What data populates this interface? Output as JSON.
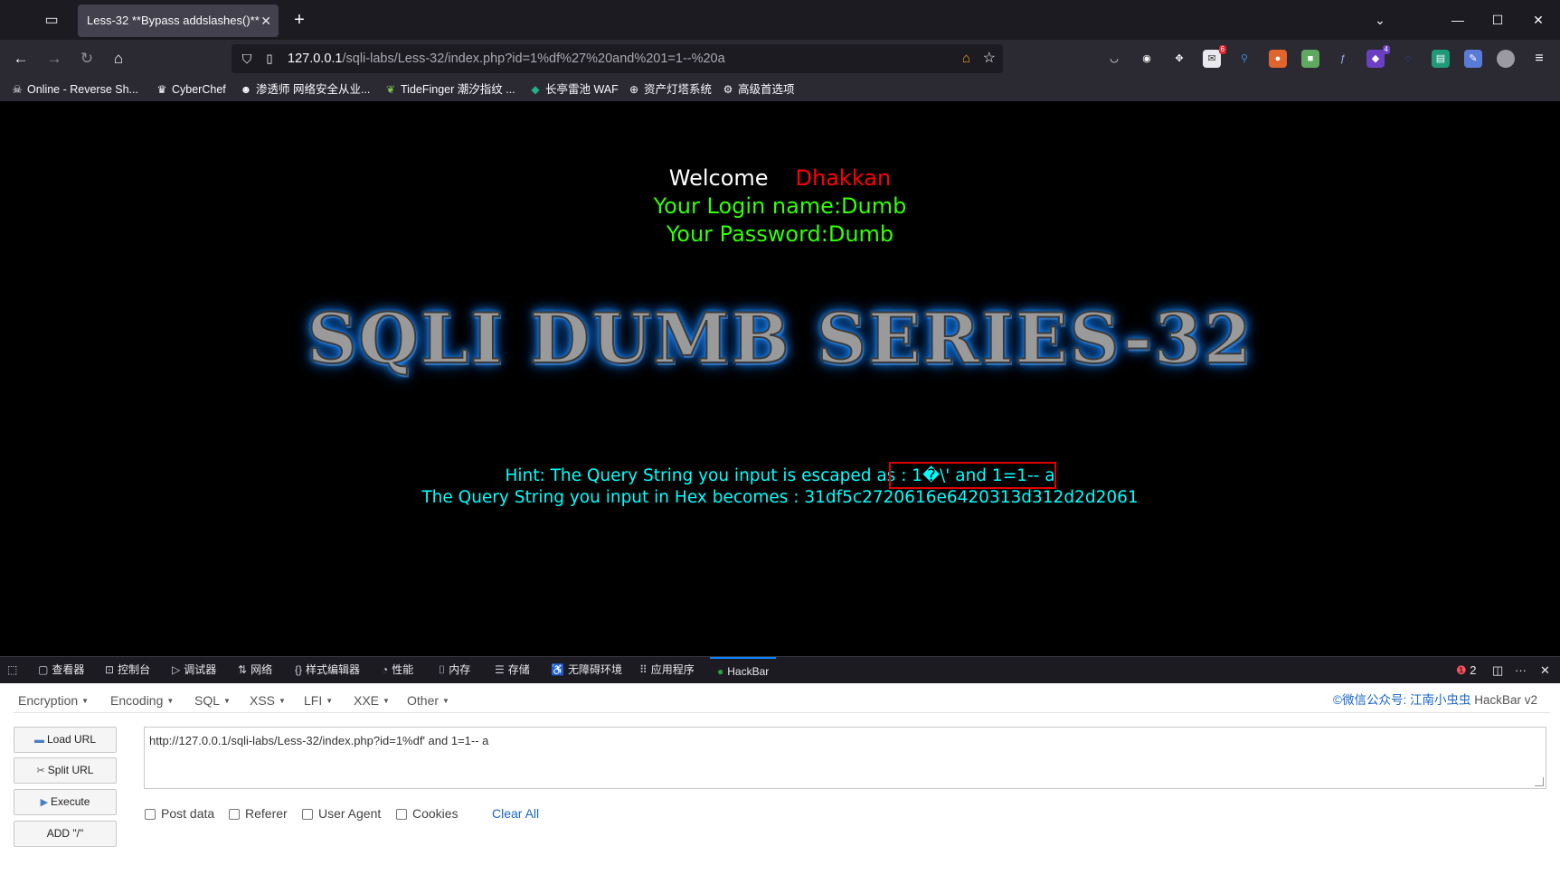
{
  "tab": {
    "title": "Less-32 **Bypass addslashes()**",
    "close": "✕",
    "new": "+"
  },
  "window": {
    "minimize": "—",
    "maximize": "☐",
    "close": "✕",
    "list_all": "⌄"
  },
  "nav": {
    "back": "←",
    "forward": "→",
    "reload": "↻",
    "home": "⌂",
    "url_host": "127.0.0.1",
    "url_rest": "/sqli-labs/Less-32/index.php?id=1%df%27%20and%201=1--%20a",
    "extension_badges": [
      "6",
      "4"
    ],
    "menu": "≡"
  },
  "bookmarks": [
    {
      "label": "Online - Reverse Sh...",
      "icon": "skull-icon",
      "glyph": "☠"
    },
    {
      "label": "CyberChef",
      "icon": "chef-hat-icon",
      "glyph": "♛"
    },
    {
      "label": "渗透师 网络安全从业...",
      "icon": "mask-icon",
      "glyph": "☻"
    },
    {
      "label": "TideFinger 潮汐指纹 ...",
      "icon": "leaf-icon",
      "glyph": "❦"
    },
    {
      "label": "长亭雷池 WAF",
      "icon": "shield-icon",
      "glyph": "◆"
    },
    {
      "label": "资产灯塔系统",
      "icon": "globe-icon",
      "glyph": "⊕"
    },
    {
      "label": "高级首选项",
      "icon": "gear-icon",
      "glyph": "⚙"
    }
  ],
  "page": {
    "welcome": "Welcome",
    "user": "Dhakkan",
    "login": "Your Login name:Dumb",
    "password": "Your Password:Dumb",
    "banner": "SQLI DUMB SERIES-32",
    "hint": "Hint: The Query String you input is escaped as : 1�\\' and 1=1-- a",
    "hex": "The Query String you input in Hex becomes : 31df5c2720616e6420313d312d2d2061"
  },
  "devtools": {
    "tabs": [
      "查看器",
      "控制台",
      "调试器",
      "网络",
      "样式编辑器",
      "性能",
      "内存",
      "存储",
      "无障碍环境",
      "应用程序",
      "HackBar"
    ],
    "error_count": "2",
    "more": "···",
    "close": "✕"
  },
  "hackbar": {
    "menu": [
      "Encryption",
      "Encoding",
      "SQL",
      "XSS",
      "LFI",
      "XXE",
      "Other"
    ],
    "credit_link": "©微信公众号: 江南小虫虫",
    "credit_name": "HackBar v2",
    "buttons": {
      "load": "Load URL",
      "split": "Split URL",
      "execute": "Execute",
      "add": "ADD \"/\""
    },
    "url_value": "http://127.0.0.1/sqli-labs/Less-32/index.php?id=1%df' and 1=1-- a",
    "checks": [
      "Post data",
      "Referer",
      "User Agent",
      "Cookies"
    ],
    "clear": "Clear All"
  }
}
